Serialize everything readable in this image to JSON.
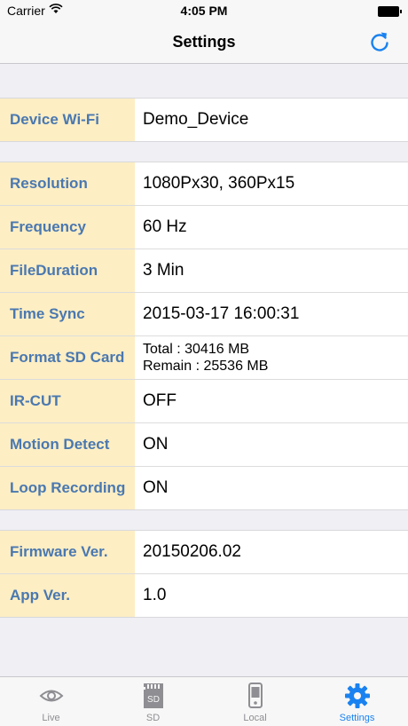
{
  "status_bar": {
    "carrier": "Carrier",
    "time": "4:05 PM"
  },
  "nav": {
    "title": "Settings",
    "refresh_icon": "refresh-icon"
  },
  "sections": [
    {
      "rows": [
        {
          "label": "Device Wi-Fi",
          "value": "Demo_Device"
        }
      ]
    },
    {
      "rows": [
        {
          "label": "Resolution",
          "value": "1080Px30, 360Px15"
        },
        {
          "label": "Frequency",
          "value": "60 Hz"
        },
        {
          "label": "FileDuration",
          "value": "3 Min"
        },
        {
          "label": "Time Sync",
          "value": "2015-03-17 16:00:31"
        },
        {
          "label": "Format SD Card",
          "value_line1": "Total :  30416 MB",
          "value_line2": "Remain :  25536 MB"
        },
        {
          "label": "IR-CUT",
          "value": "OFF"
        },
        {
          "label": "Motion Detect",
          "value": "ON"
        },
        {
          "label": "Loop Recording",
          "value": "ON"
        }
      ]
    },
    {
      "rows": [
        {
          "label": "Firmware Ver.",
          "value": "20150206.02"
        },
        {
          "label": "App Ver.",
          "value": "1.0"
        }
      ]
    }
  ],
  "tabs": [
    {
      "label": "Live",
      "icon": "eye-icon"
    },
    {
      "label": "SD",
      "icon": "sd-card-icon"
    },
    {
      "label": "Local",
      "icon": "phone-icon"
    },
    {
      "label": "Settings",
      "icon": "gear-icon",
      "active": true
    }
  ],
  "colors": {
    "accent": "#1a82f0",
    "label_bg": "#fdeec4",
    "label_text": "#4a78b0"
  }
}
